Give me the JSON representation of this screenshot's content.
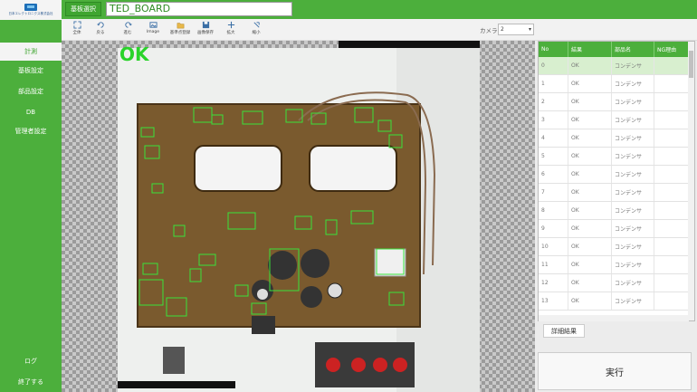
{
  "logo": {
    "text": "日本エレクトロニクス株式会社"
  },
  "sidebar": {
    "items": [
      {
        "label": "計測"
      },
      {
        "label": "基板設定"
      },
      {
        "label": "部品設定"
      },
      {
        "label": "DB"
      },
      {
        "label": "管理者設定"
      }
    ],
    "log_label": "ログ",
    "exit_label": "終了する"
  },
  "topbar": {
    "board_button": "基板選択",
    "board_name": "TED_BOARD"
  },
  "toolbar": {
    "tools": [
      {
        "label": "全体",
        "icon": "fit-icon"
      },
      {
        "label": "戻る",
        "icon": "undo-icon"
      },
      {
        "label": "進む",
        "icon": "redo-icon"
      },
      {
        "label": "Image",
        "icon": "image-icon"
      },
      {
        "label": "基準点登録",
        "icon": "folder-icon"
      },
      {
        "label": "画像保存",
        "icon": "save-icon"
      },
      {
        "label": "拡大",
        "icon": "zoom-icon"
      },
      {
        "label": "縮小",
        "icon": "shrink-icon"
      }
    ],
    "camera_label": "カメラ",
    "camera_value": "2"
  },
  "viewer": {
    "result": "OK"
  },
  "results": {
    "columns": [
      "No",
      "結果",
      "部品名",
      "NG理由"
    ],
    "rows": [
      [
        "0",
        "OK",
        "コンデンサ",
        ""
      ],
      [
        "1",
        "OK",
        "コンデンサ",
        ""
      ],
      [
        "2",
        "OK",
        "コンデンサ",
        ""
      ],
      [
        "3",
        "OK",
        "コンデンサ",
        ""
      ],
      [
        "4",
        "OK",
        "コンデンサ",
        ""
      ],
      [
        "5",
        "OK",
        "コンデンサ",
        ""
      ],
      [
        "6",
        "OK",
        "コンデンサ",
        ""
      ],
      [
        "7",
        "OK",
        "コンデンサ",
        ""
      ],
      [
        "8",
        "OK",
        "コンデンサ",
        ""
      ],
      [
        "9",
        "OK",
        "コンデンサ",
        ""
      ],
      [
        "10",
        "OK",
        "コンデンサ",
        ""
      ],
      [
        "11",
        "OK",
        "コンデンサ",
        ""
      ],
      [
        "12",
        "OK",
        "コンデンサ",
        ""
      ],
      [
        "13",
        "OK",
        "コンデンサ",
        ""
      ]
    ]
  },
  "buttons": {
    "detail": "詳細結果",
    "run": "実行"
  },
  "colors": {
    "accent": "#4caf3c",
    "ok": "#29d32a",
    "selected_row": "#d8efcf"
  }
}
